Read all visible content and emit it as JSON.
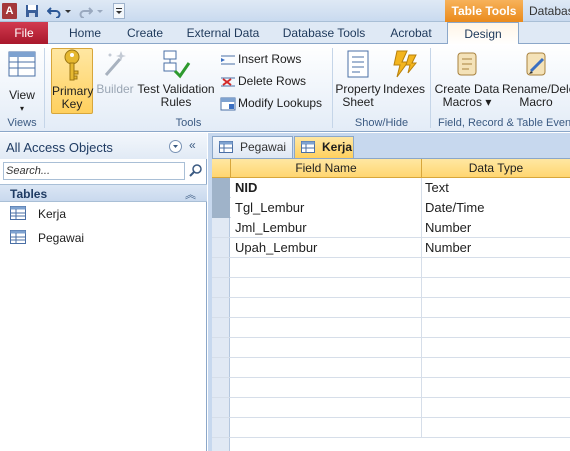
{
  "titlebar": {
    "app_icon_letter": "A",
    "context_tab": "Table Tools",
    "document_title": "Database"
  },
  "tabs": [
    {
      "label": "File"
    },
    {
      "label": "Home"
    },
    {
      "label": "Create"
    },
    {
      "label": "External Data"
    },
    {
      "label": "Database Tools"
    },
    {
      "label": "Acrobat"
    },
    {
      "label": "Design"
    }
  ],
  "ribbon": {
    "views": {
      "view_label": "View",
      "group_label": "Views"
    },
    "tools": {
      "primary_key": "Primary Key",
      "primary_key_line1": "Primary",
      "primary_key_line2": "Key",
      "builder": "Builder",
      "test_validation_line1": "Test Validation",
      "test_validation_line2": "Rules",
      "insert_rows": "Insert Rows",
      "delete_rows": "Delete Rows",
      "modify_lookups": "Modify Lookups",
      "group_label": "Tools"
    },
    "show_hide": {
      "property_sheet_line1": "Property",
      "property_sheet_line2": "Sheet",
      "indexes": "Indexes",
      "group_label": "Show/Hide"
    },
    "field_events": {
      "create_data_macros_line1": "Create Data",
      "create_data_macros_line2": "Macros",
      "rename_delete_line1": "Rename/Delete",
      "rename_delete_line2": "Macro",
      "group_label": "Field, Record & Table Events"
    }
  },
  "nav": {
    "title": "All Access Objects",
    "search_placeholder": "Search...",
    "section_label": "Tables",
    "items": [
      {
        "label": "Kerja"
      },
      {
        "label": "Pegawai"
      }
    ]
  },
  "doc_tabs": [
    {
      "label": "Pegawai"
    },
    {
      "label": "Kerja"
    }
  ],
  "grid": {
    "headers": [
      "Field Name",
      "Data Type"
    ],
    "rows": [
      {
        "field": "NID",
        "type": "Text"
      },
      {
        "field": "Tgl_Lembur",
        "type": "Date/Time"
      },
      {
        "field": "Jml_Lembur",
        "type": "Number"
      },
      {
        "field": "Upah_Lembur",
        "type": "Number"
      }
    ]
  },
  "colors": {
    "file_tab": "#b7263a",
    "context_tab": "#ee9322",
    "selection": "#ffd05e"
  }
}
